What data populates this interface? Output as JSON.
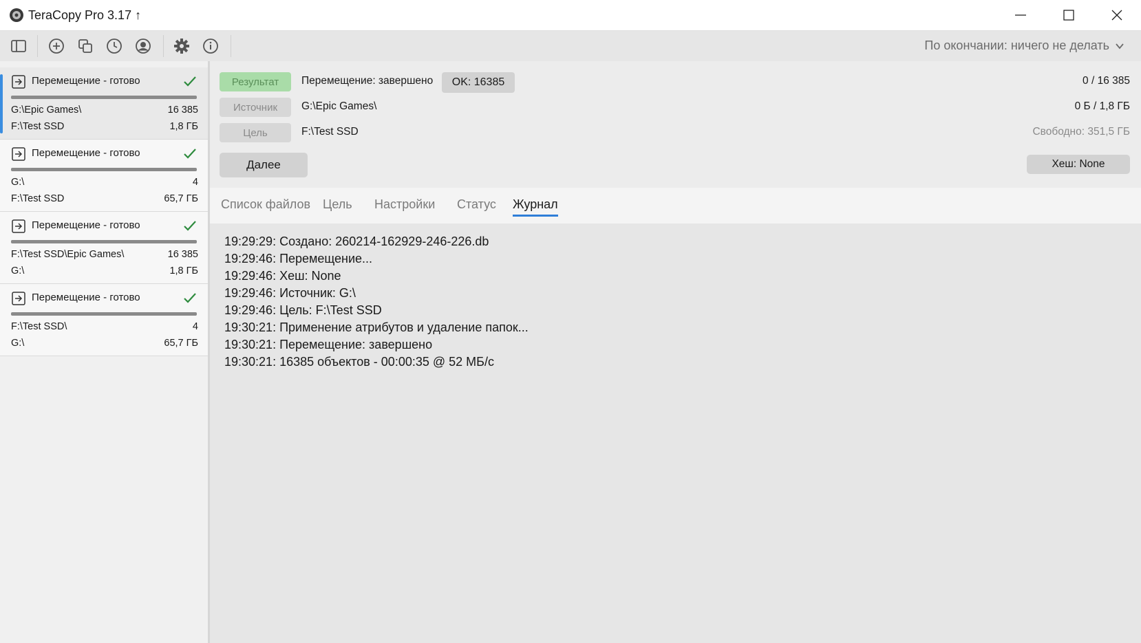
{
  "window": {
    "title": "TeraCopy Pro 3.17 ↑"
  },
  "toolbar": {
    "icons": [
      "sidebar-toggle-icon",
      "add-icon",
      "copy-icon",
      "history-icon",
      "account-icon",
      "settings-icon",
      "info-icon"
    ],
    "when_done": "По окончании: ничего не делать"
  },
  "sidebar": {
    "jobs": [
      {
        "title": "Перемещение - готово",
        "source": "G:\\Epic Games\\",
        "count": "16 385",
        "target": "F:\\Test SSD",
        "size": "1,8 ГБ",
        "selected": true
      },
      {
        "title": "Перемещение - готово",
        "source": "G:\\",
        "count": "4",
        "target": "F:\\Test SSD",
        "size": "65,7 ГБ",
        "selected": false
      },
      {
        "title": "Перемещение - готово",
        "source": "F:\\Test SSD\\Epic Games\\",
        "count": "16 385",
        "target": "G:\\",
        "size": "1,8 ГБ",
        "selected": false
      },
      {
        "title": "Перемещение - готово",
        "source": "F:\\Test SSD\\",
        "count": "4",
        "target": "G:\\",
        "size": "65,7 ГБ",
        "selected": false
      }
    ]
  },
  "info": {
    "result_label": "Результат",
    "result_text": "Перемещение: завершено",
    "ok_badge": "OK: 16385",
    "files_progress": "0 / 16 385",
    "source_label": "Источник",
    "source_value": "G:\\Epic Games\\",
    "size_progress": "0 Б / 1,8 ГБ",
    "target_label": "Цель",
    "target_value": "F:\\Test SSD",
    "free_space": "Свободно: 351,5 ГБ",
    "next_button": "Далее",
    "hash_button": "Хеш: None"
  },
  "tabs": [
    "Список файлов",
    "Цель",
    "Настройки",
    "Статус",
    "Журнал"
  ],
  "active_tab": "Журнал",
  "log": [
    "19:29:29: Создано: 260214-162929-246-226.db",
    "19:29:46: Перемещение...",
    "19:29:46: Хеш: None",
    "19:29:46: Источник: G:\\",
    "19:29:46: Цель: F:\\Test SSD",
    "19:30:21: Применение атрибутов и удаление папок...",
    "19:30:21: Перемещение: завершено",
    "19:30:21: 16385 объектов - 00:00:35 @ 52 МБ/с"
  ]
}
